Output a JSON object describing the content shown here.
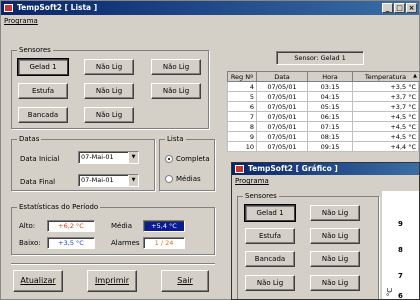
{
  "list_window": {
    "title": "TempSoft2  [ Lista ]",
    "menu": "Programa",
    "sensors": {
      "legend": "Sensores",
      "buttons": [
        "Gelad 1",
        "Não Lig",
        "Não Lig",
        "Estufa",
        "Não Lig",
        "Não Lig",
        "Bancada",
        "Não Lig"
      ]
    },
    "dates": {
      "legend": "Datas",
      "start_label": "Data Inicial",
      "start_value": "07-Mai-01",
      "end_label": "Data Final",
      "end_value": "07-Mai-01"
    },
    "list_options": {
      "legend": "Lista",
      "complete": "Completa",
      "averages": "Médias",
      "selected": "Completa"
    },
    "stats": {
      "legend": "Estatísticas do Período",
      "high_label": "Alto:",
      "high_value": "+6,2 °C",
      "low_label": "Baixo:",
      "low_value": "+3,5 °C",
      "avg_label": "Média",
      "avg_value": "+5,4 °C",
      "alarms_label": "Alarmes",
      "alarms_value": "1 / 24"
    },
    "actions": {
      "update": "Atualizar",
      "print": "Imprimir",
      "exit": "Sair"
    },
    "sensor_header": "Sensor:  Gelad 1",
    "table": {
      "columns": [
        "Reg Nº",
        "Data",
        "Hora",
        "Temperatura"
      ],
      "rows": [
        [
          "4",
          "07/05/01",
          "03:15",
          "+3,5 °C"
        ],
        [
          "5",
          "07/05/01",
          "04:15",
          "+3,7 °C"
        ],
        [
          "6",
          "07/05/01",
          "05:15",
          "+3,7 °C"
        ],
        [
          "7",
          "07/05/01",
          "06:15",
          "+4,5 °C"
        ],
        [
          "8",
          "07/05/01",
          "07:15",
          "+4,5 °C"
        ],
        [
          "9",
          "07/05/01",
          "08:15",
          "+4,5 °C"
        ],
        [
          "10",
          "07/05/01",
          "09:15",
          "+4,4 °C"
        ]
      ]
    }
  },
  "graph_window": {
    "title": "TempSoft2  [ Gráfico ]",
    "menu": "Programa",
    "sensors": {
      "legend": "Sensores",
      "buttons": [
        "Gelad 1",
        "Não Lig",
        "Estufa",
        "Não Lig",
        "Bancada",
        "Não Lig",
        "Não Lig",
        "Não Lig"
      ]
    },
    "axis_ticks": [
      "9",
      "8",
      "7",
      "6"
    ],
    "axis_unit": "°C"
  }
}
